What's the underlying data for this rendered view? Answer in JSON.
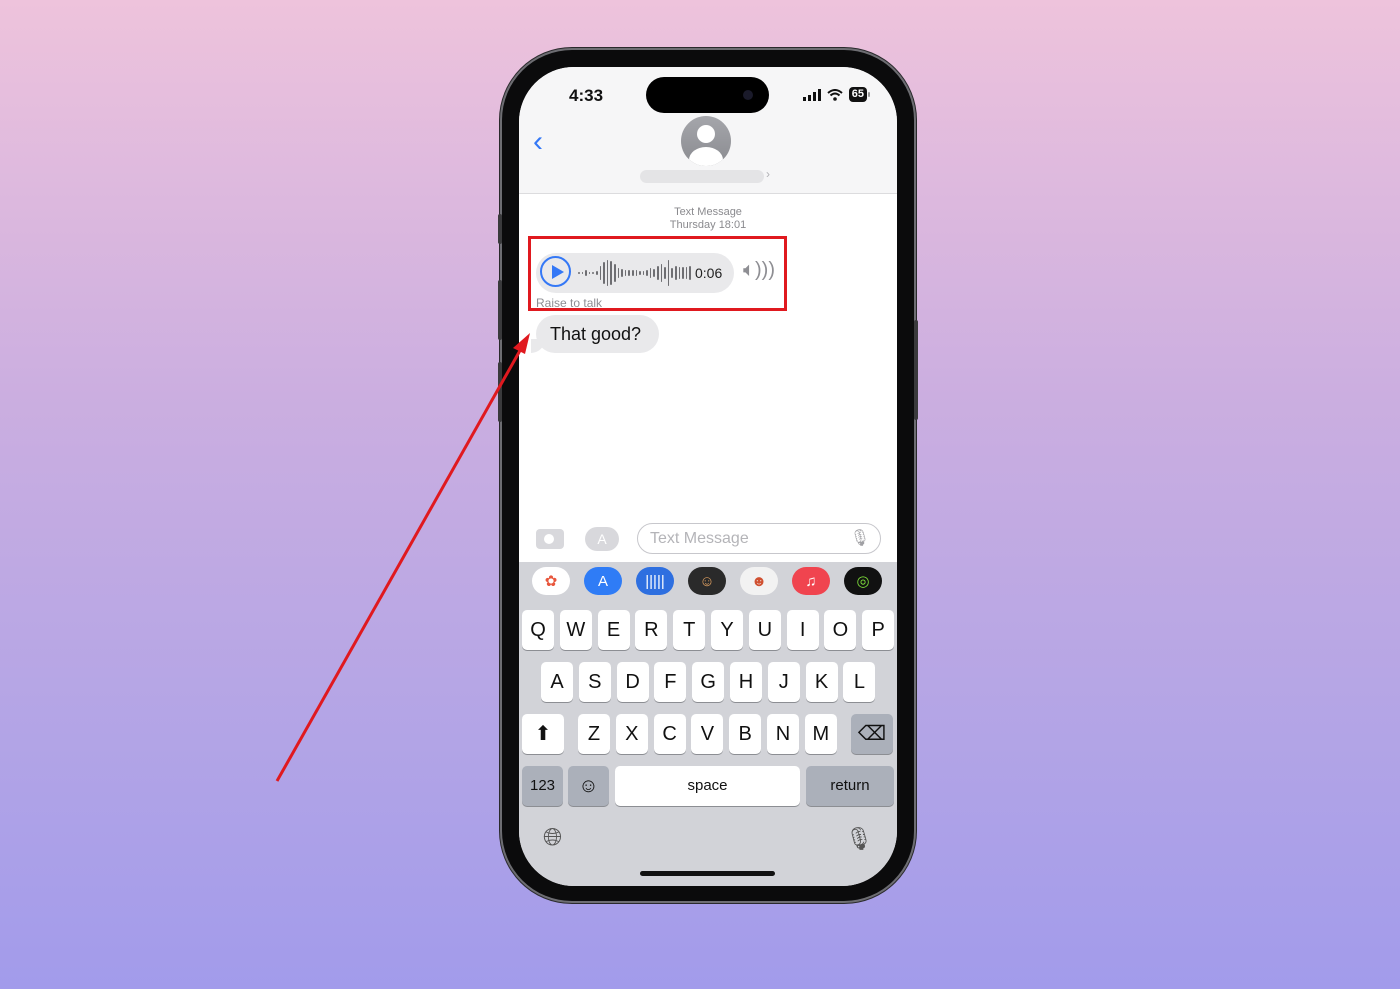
{
  "status_bar": {
    "time": "4:33",
    "battery": "65",
    "signal_icon": "signal-bars",
    "wifi_icon": "wifi"
  },
  "header": {
    "back_icon": "chevron-left",
    "contact_avatar": "person-silhouette",
    "contact_name_redacted": true
  },
  "conversation": {
    "meta_type": "Text Message",
    "meta_time": "Thursday 18:01",
    "audio_message": {
      "duration": "0:06",
      "play_icon": "play",
      "speaker_icon": "speaker-wave",
      "hint": "Raise to talk"
    },
    "messages": [
      {
        "text": "That good?",
        "direction": "incoming"
      }
    ]
  },
  "compose": {
    "camera_icon": "camera",
    "apps_icon": "app-store",
    "placeholder": "Text Message",
    "mic_icon": "microphone"
  },
  "app_drawer": {
    "apps": [
      {
        "name": "photos",
        "glyph": "✿",
        "bg": "#ffffff",
        "fg": "#e8563c"
      },
      {
        "name": "app-store",
        "glyph": "A",
        "bg": "#2f7cf6",
        "fg": "#ffffff"
      },
      {
        "name": "audio-message",
        "glyph": "|||||",
        "bg": "#2e6fe0",
        "fg": "#ffffff"
      },
      {
        "name": "memoji",
        "glyph": "☺",
        "bg": "#2a2a2a",
        "fg": "#e0a060"
      },
      {
        "name": "memoji-stickers",
        "glyph": "☻",
        "bg": "#f2f2f2",
        "fg": "#d05030"
      },
      {
        "name": "music",
        "glyph": "♫",
        "bg": "#f0444f",
        "fg": "#ffffff"
      },
      {
        "name": "activity",
        "glyph": "◎",
        "bg": "#111111",
        "fg": "#7ddc3a"
      }
    ]
  },
  "keyboard": {
    "row1": [
      "Q",
      "W",
      "E",
      "R",
      "T",
      "Y",
      "U",
      "I",
      "O",
      "P"
    ],
    "row2": [
      "A",
      "S",
      "D",
      "F",
      "G",
      "H",
      "J",
      "K",
      "L"
    ],
    "row3": [
      "Z",
      "X",
      "C",
      "V",
      "B",
      "N",
      "M"
    ],
    "shift_icon": "shift-arrow",
    "delete_icon": "delete-backward",
    "numbers_label": "123",
    "emoji_icon": "emoji-face",
    "space_label": "space",
    "return_label": "return",
    "globe_icon": "globe",
    "dictation_icon": "microphone"
  },
  "annotation": {
    "highlight_color": "#e0191f",
    "arrow_color": "#e0191f"
  }
}
